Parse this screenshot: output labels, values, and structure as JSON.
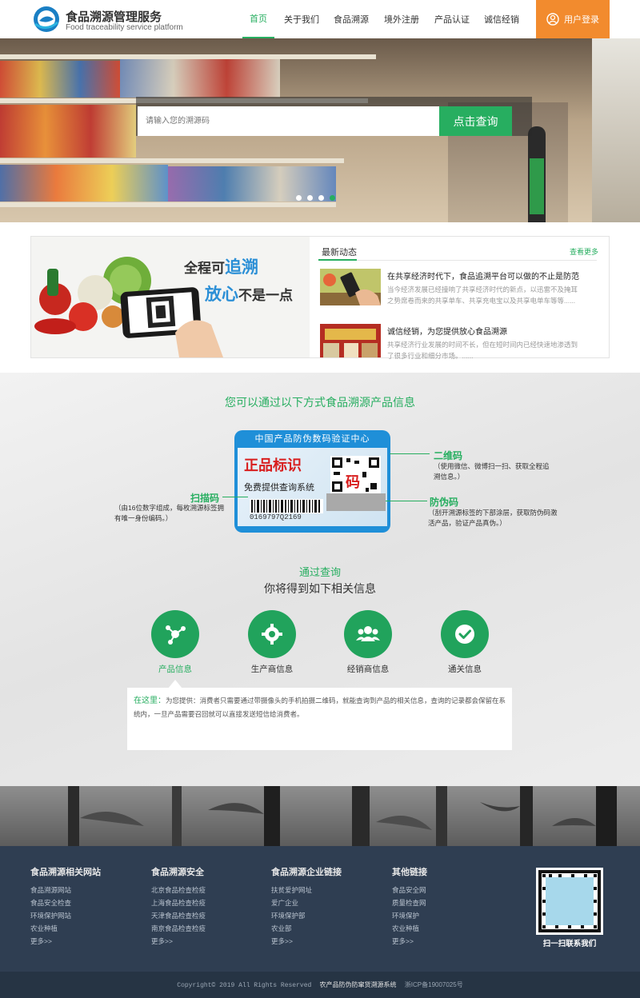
{
  "header": {
    "brand_title": "食品溯源管理服务",
    "brand_subtitle": "Food traceability service platform",
    "nav": [
      "首页",
      "关于我们",
      "食品溯源",
      "境外注册",
      "产品认证",
      "诚信经销"
    ],
    "active_nav": "首页",
    "login_label": "用户登录"
  },
  "hero": {
    "search_placeholder": "请输入您的溯源码",
    "search_button": "点击查询",
    "slide_count": 4,
    "active_slide": 4
  },
  "promo": {
    "line1_prefix": "全程可",
    "line1_highlight": "追溯",
    "line2_highlight": "放心",
    "line2_suffix": "不是一点"
  },
  "news": {
    "heading": "最新动态",
    "more_label": "查看更多",
    "items": [
      {
        "title": "在共享经济时代下，食品追溯平台可以做的不止是防范",
        "summary": "当今经济发展已经撞响了共享经济时代的新点，以迅雷不及掩耳之势席卷而来的共享单车、共享充电宝以及共享电单车等等......"
      },
      {
        "title": "诚信经销，为您提供放心食品溯源",
        "summary": "共享经济行业发展的时间不长，但在短时间内已经快速地渗透到了很多行业和细分市场。......"
      }
    ]
  },
  "methods": {
    "title": "您可以通过以下方式食品溯源产品信息",
    "label": {
      "header": "中国产品防伪数码验证中心",
      "big_text": "正品标识",
      "sub_text": "免费提供查询系统",
      "code_char": "码",
      "serial": "0169797Q2169"
    },
    "callouts": {
      "qr_title": "二维码",
      "qr_desc": "（使用微信、微博扫一扫、获取全程追溯信息。）",
      "scan_title": "扫描码",
      "scan_desc": "（由16位数字组成，每枚溯源标签拥有唯一身份编码。）",
      "anti_title": "防伪码",
      "anti_desc": "（刮开溯源标签的下部涂层，获取防伪码激活产品，验证产品真伪。）"
    }
  },
  "results": {
    "title": "通过查询",
    "subtitle": "你将得到如下相关信息",
    "items": [
      {
        "label": "产品信息",
        "icon": "molecule-icon",
        "active": true
      },
      {
        "label": "生产商信息",
        "icon": "gear-icon",
        "active": false
      },
      {
        "label": "经销商信息",
        "icon": "users-icon",
        "active": false
      },
      {
        "label": "通关信息",
        "icon": "check-icon",
        "active": false
      }
    ],
    "note_key": "在这里：",
    "note_text": "为您提供：消费者只需要通过带摄像头的手机拍摄二维码，就能查询到产品的相关信息，查询的记录都会保留在系统内，一旦产品需要召回就可以直接发送短信给消费者。"
  },
  "footer": {
    "columns": [
      {
        "heading": "食品溯源相关网站",
        "links": [
          "食品溯源网站",
          "食品安全检查",
          "环境保护网站",
          "农业种植",
          "更多>>"
        ]
      },
      {
        "heading": "食品溯源安全",
        "links": [
          "北京食品检查检疫",
          "上海食品检查检疫",
          "天津食品检查检疫",
          "南京食品检查检疫",
          "更多>>"
        ]
      },
      {
        "heading": "食品溯源企业链接",
        "links": [
          "扶贫爱护网址",
          "爱广企业",
          "环境保护部",
          "农业部",
          "更多>>"
        ]
      },
      {
        "heading": "其他链接",
        "links": [
          "食品安全网",
          "质量检查网",
          "环境保护",
          "农业种植",
          "更多>>"
        ]
      }
    ],
    "qr_caption": "扫一扫联系我们",
    "copyright": "Copyright© 2019  All Rights Reserved",
    "system_name": "农产品防伪防窜货溯源系统",
    "icp": "浙ICP备19007025号"
  },
  "colors": {
    "accent_green": "#27ae60",
    "login_orange": "#f28b2e",
    "footer_bg": "#2f3e52",
    "label_blue": "#1f8fd8"
  }
}
